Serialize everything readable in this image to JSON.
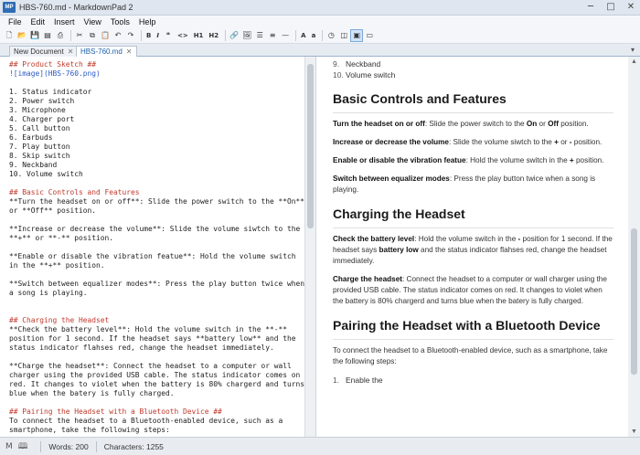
{
  "window": {
    "title": "HBS-760.md - MarkdownPad 2",
    "app_icon_text": "MP",
    "buttons": {
      "minimize": "─",
      "maximize": "□",
      "close": "✕"
    }
  },
  "menu": [
    "File",
    "Edit",
    "Insert",
    "View",
    "Tools",
    "Help"
  ],
  "toolbar": {
    "h1": "H1",
    "h2": "H2",
    "italic": "I",
    "bold": "B",
    "quote": "❝",
    "code": "<>",
    "hr": "—",
    "upper": "A",
    "lower": "a"
  },
  "tabs": [
    {
      "label": "New Document",
      "close": "✕"
    },
    {
      "label": "HBS-760.md",
      "close": "✕"
    }
  ],
  "editor": {
    "lines": [
      {
        "t": "## Product Sketch ##",
        "c": "md-h"
      },
      {
        "t": "![image](HBS-760.png)",
        "c": "md-img"
      },
      {
        "t": "",
        "c": ""
      },
      {
        "t": "1. Status indicator",
        "c": ""
      },
      {
        "t": "2. Power switch",
        "c": ""
      },
      {
        "t": "3. Microphone",
        "c": ""
      },
      {
        "t": "4. Charger port",
        "c": ""
      },
      {
        "t": "5. Call button",
        "c": ""
      },
      {
        "t": "6. Earbuds",
        "c": ""
      },
      {
        "t": "7. Play button",
        "c": ""
      },
      {
        "t": "8. Skip switch",
        "c": ""
      },
      {
        "t": "9. Neckband",
        "c": ""
      },
      {
        "t": "10. Volume switch",
        "c": ""
      },
      {
        "t": "",
        "c": ""
      },
      {
        "t": "## Basic Controls and Features",
        "c": "md-h"
      },
      {
        "t": "**Turn the headset on or off**: Slide the power switch to the **On**",
        "c": ""
      },
      {
        "t": "or **Off** position.",
        "c": ""
      },
      {
        "t": "",
        "c": ""
      },
      {
        "t": "**Increase or decrease the volume**: Slide the volume siwtch to the",
        "c": ""
      },
      {
        "t": "**+** or **-** position.",
        "c": ""
      },
      {
        "t": "",
        "c": ""
      },
      {
        "t": "**Enable or disable the vibration featue**: Hold the volume switch",
        "c": ""
      },
      {
        "t": "in the **+** position.",
        "c": ""
      },
      {
        "t": "",
        "c": ""
      },
      {
        "t": "**Switch between equalizer modes**: Press the play button twice when",
        "c": ""
      },
      {
        "t": "a song is playing.",
        "c": ""
      },
      {
        "t": "",
        "c": ""
      },
      {
        "t": "",
        "c": ""
      },
      {
        "t": "## Charging the Headset",
        "c": "md-h"
      },
      {
        "t": "**Check the battery level**: Hold the volume switch in the **-**",
        "c": ""
      },
      {
        "t": "position for 1 second. If the headset says **battery low** and the",
        "c": ""
      },
      {
        "t": "status indicator flahses red, change the headset immediately.",
        "c": ""
      },
      {
        "t": "",
        "c": ""
      },
      {
        "t": "**Charge the headset**: Connect the headset to a computer or wall",
        "c": ""
      },
      {
        "t": "charger using the provided USB cable. The status indicator comes on",
        "c": ""
      },
      {
        "t": "red. It changes to violet when the battery is 80% chargerd and turns",
        "c": ""
      },
      {
        "t": "blue when the batery is fully charged.",
        "c": ""
      },
      {
        "t": "",
        "c": ""
      },
      {
        "t": "## Pairing the Headset with a Bluetooth Device ##",
        "c": "md-h"
      },
      {
        "t": "To connect the headset to a Bluetooth-enabled device, such as a",
        "c": ""
      },
      {
        "t": "smartphone, take the following steps:",
        "c": ""
      }
    ]
  },
  "preview": {
    "list_tail": [
      {
        "n": "9.",
        "t": "Neckband"
      },
      {
        "n": "10.",
        "t": "Volume switch"
      }
    ],
    "h_basic": "Basic Controls and Features",
    "p1_b": "Turn the headset on or off",
    "p1_a": ": Slide the power switch to the ",
    "p1_on": "On",
    "p1_or": " or ",
    "p1_off": "Off",
    "p1_end": " position.",
    "p2_b": "Increase or decrease the volume",
    "p2_a": ": Slide the volume siwtch to the ",
    "p2_plus": "+",
    "p2_or": " or ",
    "p2_minus": "-",
    "p2_end": " position.",
    "p3_b": "Enable or disable the vibration featue",
    "p3_a": ": Hold the volume switch in the ",
    "p3_plus": "+",
    "p3_end": " position.",
    "p4_b": "Switch between equalizer modes",
    "p4_a": ": Press the play button twice when a song is playing.",
    "h_charging": "Charging the Headset",
    "p5_b": "Check the battery level",
    "p5_a": ": Hold the volume switch in the ",
    "p5_minus": "-",
    "p5_mid": " position for 1 second. If the headset says ",
    "p5_low": "battery low",
    "p5_end": " and the status indicator flahses red, change the headset immediately.",
    "p6_b": "Charge the headset",
    "p6_a": ": Connect the headset to a computer or wall charger using the provided USB cable. The status indicator comes on red. It changes to violet when the battery is 80% chargerd and turns blue when the batery is fully charged.",
    "h_pairing": "Pairing the Headset with a Bluetooth Device",
    "p7": "To connect the headset to a Bluetooth-enabled device, such as a smartphone, take the following steps:",
    "step1_n": "1.",
    "step1": "Enable the"
  },
  "status": {
    "words": "Words: 200",
    "characters": "Characters: 1255"
  }
}
